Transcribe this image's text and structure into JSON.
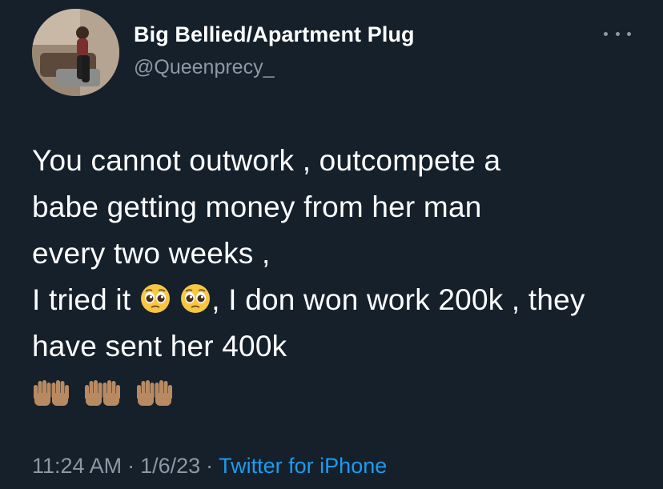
{
  "author": {
    "display_name": "Big Bellied/Apartment Plug",
    "handle": "@Queenprecy_",
    "avatar_icon": "profile-photo"
  },
  "tweet": {
    "lines": [
      "You cannot outwork , outcompete a",
      "babe getting money from her man",
      "every two weeks ,"
    ],
    "line4_prefix": "I tried it",
    "line4_suffix": ", I don won work 200k , they",
    "line5": "have sent her 400k",
    "emoji_face": "pleading-face-icon",
    "emoji_hands": "raised-hands-icon"
  },
  "meta": {
    "time": "11:24 AM",
    "date": "1/6/23",
    "separator": "·",
    "source": "Twitter for iPhone"
  },
  "colors": {
    "background": "#15202b",
    "text": "#ffffff",
    "secondary": "#8b98a5",
    "link": "#1d9bf0"
  }
}
